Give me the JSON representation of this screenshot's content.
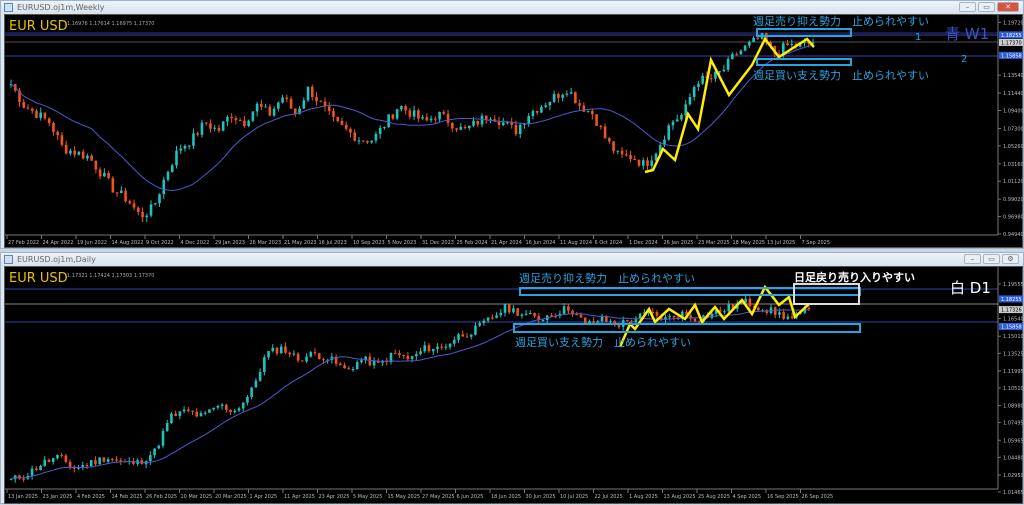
{
  "weekly": {
    "window_title": "EURUSD.oj1m,Weekly",
    "symbol": "EUR USD",
    "ohlc": "1.16976 1.17614 1.16975 1.17370",
    "resistance_label": "週足売り抑え勢力　止められやすい",
    "support_label": "週足買い支え勢力　止められやすい",
    "tf_label": "青 W1",
    "line1_label": "1",
    "line2_label": "2",
    "price_ticks": [
      "1.19720",
      "1.13540",
      "1.11440",
      "1.09400",
      "1.07300",
      "1.05260",
      "1.03160",
      "1.01120",
      "0.99020",
      "0.96980",
      "0.94940"
    ],
    "tags": {
      "line1": "1.18255",
      "current": "1.17370",
      "line2": "1.15858"
    },
    "dates": [
      "27 Feb 2022",
      "24 Apr 2022",
      "19 Jun 2022",
      "14 Aug 2022",
      "9 Oct 2022",
      "4 Dec 2022",
      "29 Jan 2023",
      "26 Mar 2023",
      "21 May 2023",
      "16 Jul 2023",
      "10 Sep 2023",
      "5 Nov 2023",
      "31 Dec 2023",
      "25 Feb 2024",
      "21 Apr 2024",
      "16 Jun 2024",
      "11 Aug 2024",
      "6 Oct 2024",
      "1 Dec 2024",
      "26 Jan 2025",
      "23 Mar 2025",
      "18 May 2025",
      "13 Jul 2025",
      "7 Sep 2025"
    ],
    "close_anchors": [
      1.125,
      1.1,
      1.09,
      1.08,
      1.05,
      1.045,
      1.04,
      1.02,
      1.0,
      0.99,
      0.97,
      0.98,
      1.02,
      1.05,
      1.06,
      1.08,
      1.07,
      1.09,
      1.08,
      1.1,
      1.09,
      1.11,
      1.09,
      1.12,
      1.1,
      1.08,
      1.07,
      1.06,
      1.06,
      1.08,
      1.1,
      1.09,
      1.08,
      1.09,
      1.08,
      1.07,
      1.08,
      1.09,
      1.08,
      1.07,
      1.09,
      1.1,
      1.11,
      1.12,
      1.1,
      1.09,
      1.06,
      1.04,
      1.04,
      1.03,
      1.05,
      1.08,
      1.09,
      1.13,
      1.13,
      1.14,
      1.16,
      1.17,
      1.18,
      1.16,
      1.17,
      1.17,
      1.1737
    ]
  },
  "daily": {
    "window_title": "EURUSD.oj1m,Daily",
    "symbol": "EUR USD",
    "ohlc": "1.17321 1.17424 1.17303 1.17370",
    "resistance_label": "週足売り抑え勢力　止められやすい",
    "support_label": "週足買い支え勢力　止められやすい",
    "daily_label": "日足戻り売り入りやすい",
    "tf_label": "白 D1",
    "price_ticks": [
      "1.19555",
      "1.16540",
      "1.15010",
      "1.13525",
      "1.11995",
      "1.10510",
      "1.08980",
      "1.07495",
      "1.05965",
      "1.04480",
      "1.02950",
      "1.01465"
    ],
    "tags": {
      "line1": "1.18255",
      "current": "1.17326",
      "line2": "1.15858"
    },
    "dates": [
      "13 Jan 2025",
      "23 Jan 2025",
      "4 Feb 2025",
      "14 Feb 2025",
      "26 Feb 2025",
      "10 Mar 2025",
      "20 Mar 2025",
      "1 Apr 2025",
      "11 Apr 2025",
      "23 Apr 2025",
      "5 May 2025",
      "15 May 2025",
      "27 May 2025",
      "6 Jun 2025",
      "18 Jun 2025",
      "30 Jun 2025",
      "10 Jul 2025",
      "22 Jul 2025",
      "1 Aug 2025",
      "13 Aug 2025",
      "25 Aug 2025",
      "4 Sep 2025",
      "16 Sep 2025",
      "26 Sep 2025"
    ],
    "close_anchors": [
      1.025,
      1.03,
      1.04,
      1.045,
      1.035,
      1.04,
      1.045,
      1.04,
      1.04,
      1.05,
      1.08,
      1.085,
      1.08,
      1.09,
      1.085,
      1.1,
      1.135,
      1.14,
      1.13,
      1.135,
      1.13,
      1.12,
      1.13,
      1.125,
      1.135,
      1.13,
      1.14,
      1.14,
      1.15,
      1.155,
      1.165,
      1.175,
      1.17,
      1.165,
      1.17,
      1.175,
      1.16,
      1.165,
      1.16,
      1.165,
      1.17,
      1.165,
      1.17,
      1.165,
      1.17,
      1.175,
      1.18,
      1.175,
      1.17,
      1.165,
      1.1737
    ]
  },
  "colors": {
    "bull": "#1fc2bd",
    "bear": "#f0541e",
    "ma": "#4a5bd0",
    "zone": "#27a3e0",
    "zigzag": "#ffee00",
    "symbol": "#e8c100"
  }
}
